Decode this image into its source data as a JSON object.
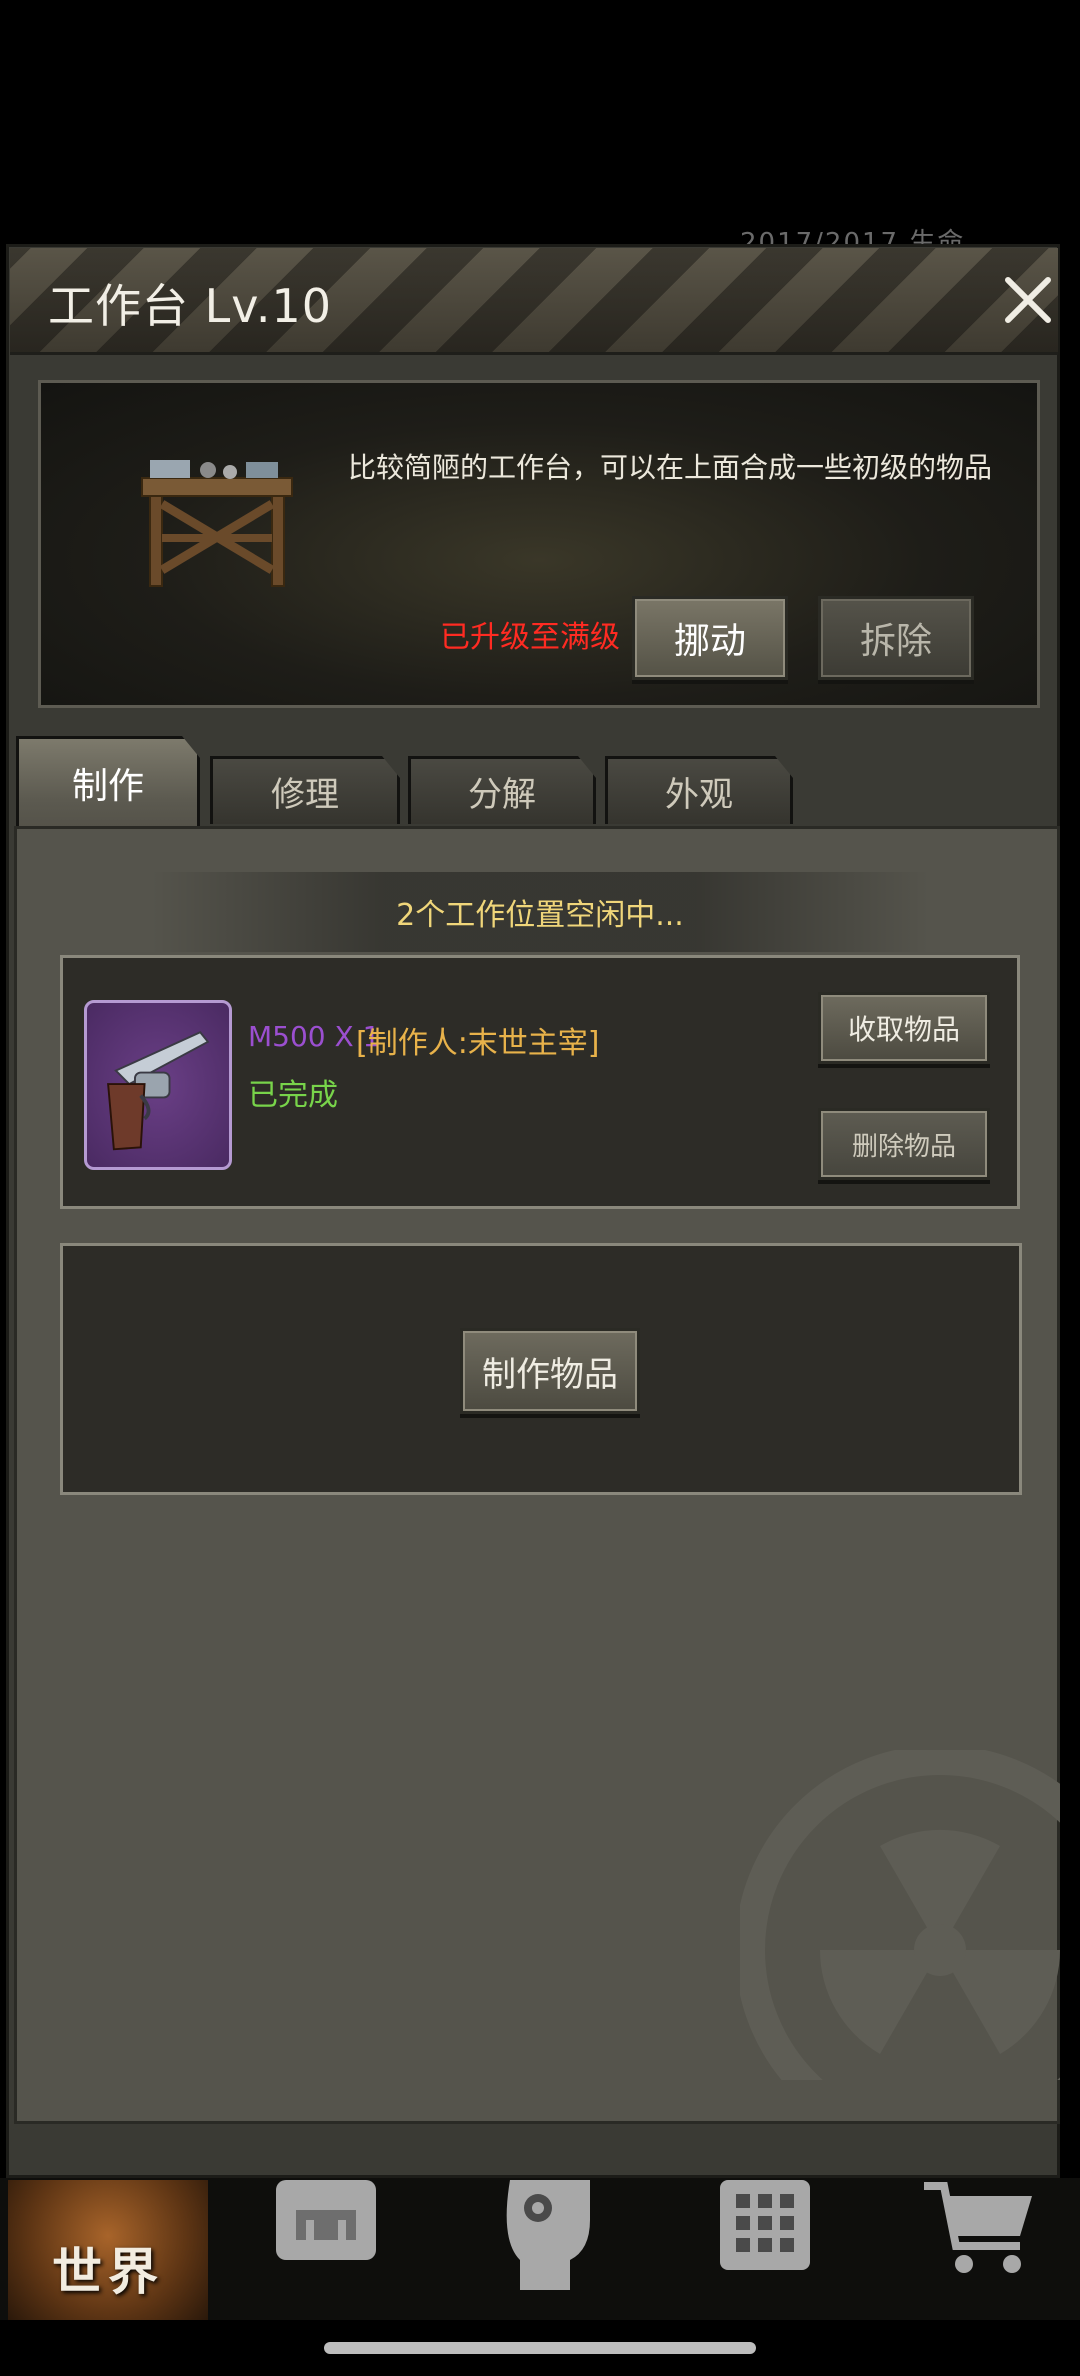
{
  "background": {
    "hint_text": "2017/2017    生命"
  },
  "modal": {
    "title": "工作台 Lv.10",
    "description": "比较简陋的工作台，可以在上面合成一些初级的物品",
    "max_level_text": "已升级至满级",
    "move_label": "挪动",
    "dismantle_label": "拆除"
  },
  "tabs": [
    {
      "label": "制作",
      "active": true
    },
    {
      "label": "修理",
      "active": false
    },
    {
      "label": "分解",
      "active": false
    },
    {
      "label": "外观",
      "active": false
    }
  ],
  "craft": {
    "slots_status": "2个工作位置空闲中...",
    "item": {
      "name": "M500 X 1",
      "maker": "[制作人:末世主宰]",
      "status": "已完成",
      "icon": "revolver-icon"
    },
    "collect_label": "收取物品",
    "delete_label": "删除物品",
    "craft_label": "制作物品"
  },
  "navbar": {
    "world_label": "世界",
    "icons": [
      "backpack-icon",
      "head-gear-icon",
      "calculator-icon",
      "cart-icon"
    ]
  },
  "colors": {
    "max_level": "#ff2b22",
    "item_name": "#9b4fd0",
    "maker": "#e8b24a",
    "done": "#78d44a",
    "slots_status": "#f0d67a"
  }
}
